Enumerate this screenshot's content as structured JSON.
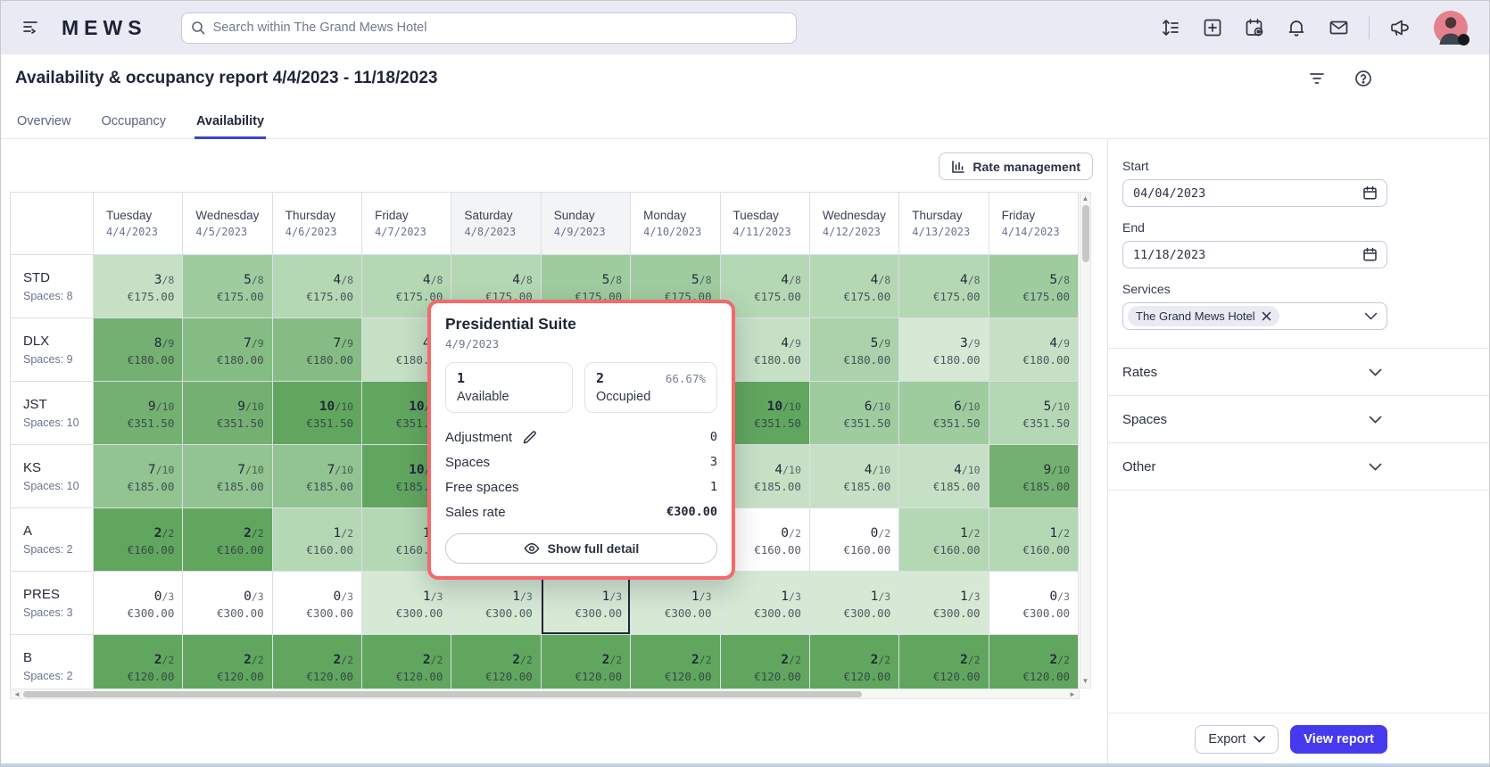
{
  "topbar": {
    "logo": "MEWS",
    "search": {
      "placeholder": "Search within The Grand Mews Hotel"
    }
  },
  "header": {
    "title": "Availability & occupancy report 4/4/2023 - 11/18/2023",
    "tabs": [
      {
        "label": "Overview",
        "active": false
      },
      {
        "label": "Occupancy",
        "active": false
      },
      {
        "label": "Availability",
        "active": true
      }
    ]
  },
  "toolbar": {
    "rate_management": "Rate management"
  },
  "grid": {
    "columns": [
      {
        "day": "Tuesday",
        "date": "4/4/2023",
        "weekend": false
      },
      {
        "day": "Wednesday",
        "date": "4/5/2023",
        "weekend": false
      },
      {
        "day": "Thursday",
        "date": "4/6/2023",
        "weekend": false
      },
      {
        "day": "Friday",
        "date": "4/7/2023",
        "weekend": false
      },
      {
        "day": "Saturday",
        "date": "4/8/2023",
        "weekend": true
      },
      {
        "day": "Sunday",
        "date": "4/9/2023",
        "weekend": true
      },
      {
        "day": "Monday",
        "date": "4/10/2023",
        "weekend": false
      },
      {
        "day": "Tuesday",
        "date": "4/11/2023",
        "weekend": false
      },
      {
        "day": "Wednesday",
        "date": "4/12/2023",
        "weekend": false
      },
      {
        "day": "Thursday",
        "date": "4/13/2023",
        "weekend": false
      },
      {
        "day": "Friday",
        "date": "4/14/2023",
        "weekend": false
      }
    ],
    "rows": [
      {
        "code": "STD",
        "spaces": "Spaces: 8",
        "capacity": 8,
        "rate": "€175.00",
        "occupied": [
          3,
          5,
          4,
          4,
          4,
          5,
          5,
          4,
          4,
          4,
          5
        ]
      },
      {
        "code": "DLX",
        "spaces": "Spaces: 9",
        "capacity": 9,
        "rate": "€180.00",
        "occupied": [
          8,
          7,
          7,
          4,
          null,
          null,
          null,
          4,
          5,
          3,
          4
        ]
      },
      {
        "code": "JST",
        "spaces": "Spaces: 10",
        "capacity": 10,
        "rate": "€351.50",
        "occupied": [
          9,
          9,
          10,
          10,
          null,
          null,
          null,
          10,
          6,
          6,
          5
        ]
      },
      {
        "code": "KS",
        "spaces": "Spaces: 10",
        "capacity": 10,
        "rate": "€185.00",
        "occupied": [
          7,
          7,
          7,
          10,
          null,
          null,
          null,
          4,
          4,
          4,
          9
        ]
      },
      {
        "code": "A",
        "spaces": "Spaces: 2",
        "capacity": 2,
        "rate": "€160.00",
        "occupied": [
          2,
          2,
          1,
          1,
          null,
          null,
          null,
          0,
          0,
          1,
          1
        ]
      },
      {
        "code": "PRES",
        "spaces": "Spaces: 3",
        "capacity": 3,
        "rate": "€300.00",
        "occupied": [
          0,
          0,
          0,
          1,
          1,
          1,
          1,
          1,
          1,
          1,
          0
        ],
        "selected_col": 5
      },
      {
        "code": "B",
        "spaces": "Spaces: 2",
        "capacity": 2,
        "rate": "€120.00",
        "occupied": [
          2,
          2,
          2,
          2,
          2,
          2,
          2,
          2,
          2,
          2,
          2
        ]
      }
    ]
  },
  "popup": {
    "title": "Presidential Suite",
    "date": "4/9/2023",
    "available": {
      "value": "1",
      "label": "Available"
    },
    "occupied": {
      "value": "2",
      "label": "Occupied",
      "percent": "66.67%"
    },
    "rows": [
      {
        "label": "Adjustment",
        "value": "0",
        "editable": true
      },
      {
        "label": "Spaces",
        "value": "3",
        "editable": false
      },
      {
        "label": "Free spaces",
        "value": "1",
        "editable": false
      },
      {
        "label": "Sales rate",
        "value": "€300.00",
        "editable": false,
        "strong": true
      }
    ],
    "action": "Show full detail"
  },
  "sidebar": {
    "start": {
      "label": "Start",
      "value": "04/04/2023"
    },
    "end": {
      "label": "End",
      "value": "11/18/2023"
    },
    "services": {
      "label": "Services",
      "chip": "The Grand Mews Hotel"
    },
    "sections": [
      "Rates",
      "Spaces",
      "Other"
    ],
    "export_label": "Export",
    "view_report_label": "View report"
  },
  "colors": {
    "accent": "#4639ee",
    "tab_underline": "#3d43d8",
    "highlight_border": "#f4696b",
    "occupancy_scale": [
      "#ffffff",
      "#d6e9d5",
      "#c6e0c5",
      "#b5d8b4",
      "#abd2aa",
      "#9fcc9e",
      "#92c491",
      "#85bc83",
      "#74b071",
      "#61a65f"
    ]
  }
}
